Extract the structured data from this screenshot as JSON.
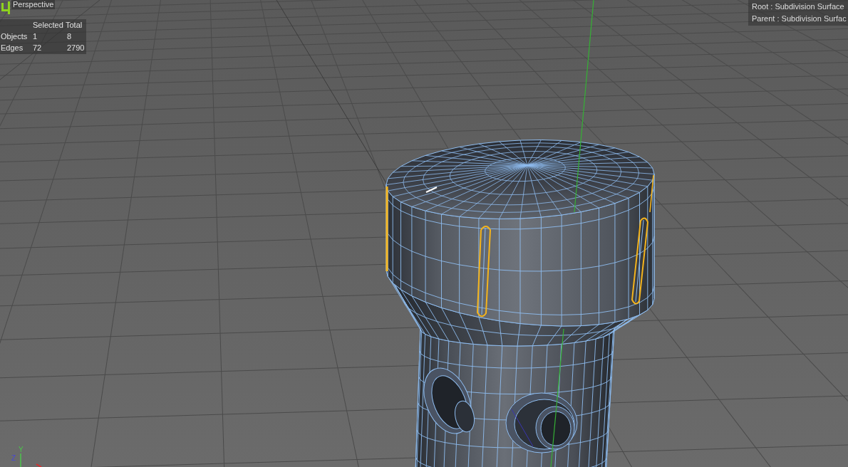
{
  "viewport": {
    "label": "Perspective"
  },
  "stats": {
    "columns": [
      "Selected",
      "Total"
    ],
    "rows": [
      {
        "label": "Objects",
        "values": [
          "1",
          "8"
        ]
      },
      {
        "label": "Edges",
        "values": [
          "72",
          "2790"
        ]
      }
    ]
  },
  "hierarchy": [
    "Root : Subdivision Surface",
    "Parent : Subdivision Surfac"
  ],
  "axis_gizmo": {
    "axes": [
      {
        "label": "Y",
        "color": "#4cc44c"
      },
      {
        "label": "Z",
        "color": "#4848d8"
      }
    ]
  }
}
